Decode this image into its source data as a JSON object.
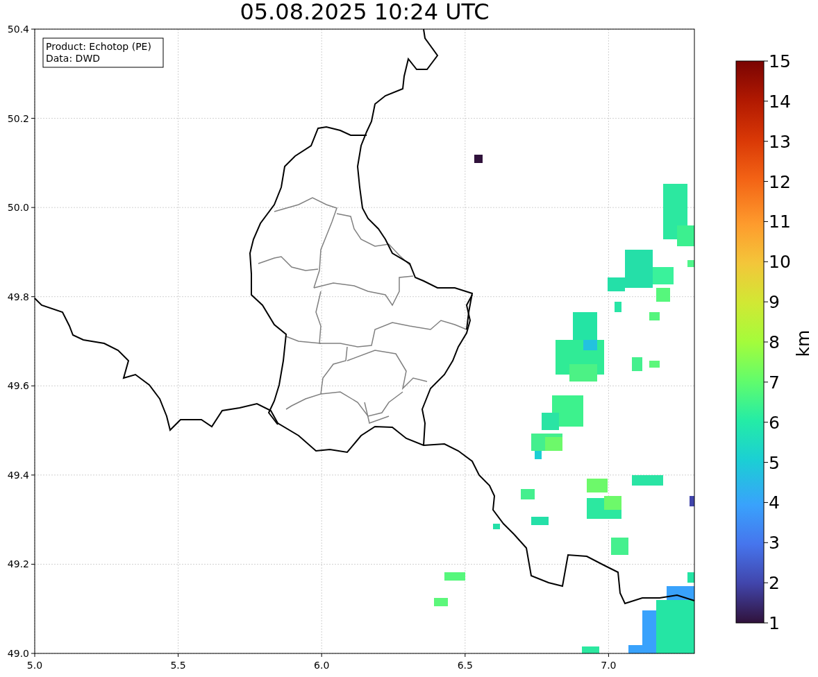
{
  "title": "05.08.2025 10:24 UTC",
  "legend": [
    "Product: Echotop (PE)",
    "Data: DWD"
  ],
  "x_axis": {
    "ticks": [
      "5.0",
      "5.5",
      "6.0",
      "6.5",
      "7.0"
    ]
  },
  "y_axis": {
    "ticks": [
      "50.4",
      "50.2",
      "50.0",
      "49.8",
      "49.6",
      "49.4",
      "49.2",
      "49.0"
    ]
  },
  "colorbar": {
    "label": "km",
    "ticks": [
      "15",
      "14",
      "13",
      "12",
      "11",
      "10",
      "9",
      "8",
      "7",
      "6",
      "5",
      "4",
      "3",
      "2",
      "1"
    ]
  }
}
